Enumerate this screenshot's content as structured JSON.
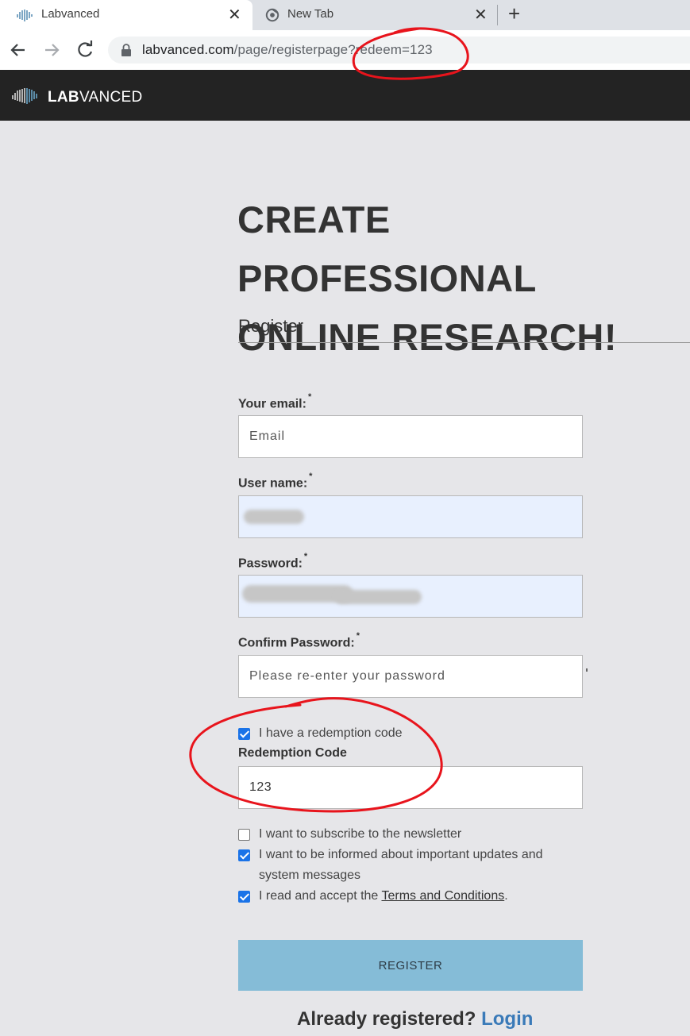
{
  "browser": {
    "tabs": [
      {
        "title": "Labvanced",
        "active": true,
        "close": "✕"
      },
      {
        "title": "New Tab",
        "active": false,
        "close": "✕"
      }
    ],
    "new_tab": "+",
    "url_host": "labvanced.com",
    "url_path": "/page/registerpage?redeem=123"
  },
  "header": {
    "logo_bold": "LAB",
    "logo_rest": "VANCED"
  },
  "main": {
    "headline_line1": "CREATE PROFESSIONAL",
    "headline_line2": "ONLINE RESEARCH!",
    "section_title": "Register"
  },
  "form": {
    "email_label": "Your email:",
    "email_placeholder": "Email",
    "username_label": "User name:",
    "password_label": "Password:",
    "confirm_label": "Confirm Password:",
    "confirm_placeholder": "Please re-enter your password",
    "required_mark": "*",
    "redemption_check": "I have a redemption code",
    "redemption_label": "Redemption Code",
    "redemption_value": "123",
    "newsletter_check": "I want to subscribe to the newsletter",
    "updates_check_line1": "I want to be informed about important updates and",
    "updates_check_line2": "system messages",
    "terms_prefix": "I read and accept the ",
    "terms_link": "Terms and Conditions",
    "terms_suffix": ".",
    "register_button": "REGISTER",
    "already_text": "Already registered? ",
    "login_link": "Login"
  },
  "checkbox_states": {
    "redemption": true,
    "newsletter": false,
    "updates": true,
    "terms": true
  },
  "colors": {
    "header_bg": "#232323",
    "page_bg": "#e6e6e9",
    "button_bg": "#85bcd7",
    "link": "#3a7ab8",
    "annotation": "#e8141c"
  }
}
